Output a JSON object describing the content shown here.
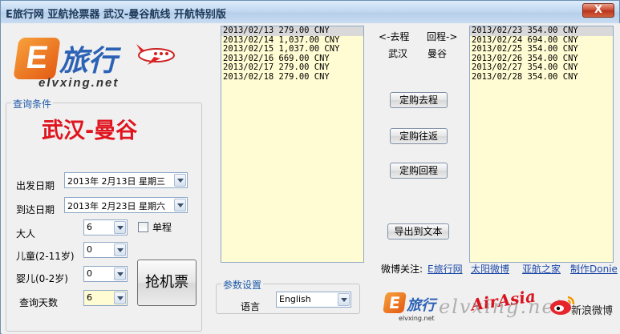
{
  "window": {
    "title": "E旅行网 亚航抢票器 武汉-曼谷航线 开航特别版",
    "close_label": "X"
  },
  "logo": {
    "mark": "E",
    "text": "旅行",
    "url": "elvxing.net"
  },
  "query": {
    "group_label": "查询条件",
    "route": "武汉-曼谷",
    "depart_label": "出发日期",
    "depart_value": "2013年 2月13日 星期三",
    "arrive_label": "到达日期",
    "arrive_value": "2013年 2月23日 星期六",
    "adult_label": "大人",
    "adult_value": "6",
    "oneway_label": "单程",
    "child_label": "儿童(2-11岁)",
    "child_value": "0",
    "infant_label": "婴儿(0-2岁)",
    "infant_value": "0",
    "days_label": "查询天数",
    "days_value": "6",
    "grab_button": "抢机票"
  },
  "params": {
    "group_label": "参数设置",
    "language_label": "语言",
    "language_value": "English"
  },
  "outbound_list": [
    "2013/02/13 279.00 CNY",
    "2013/02/14 1,037.00 CNY",
    "2013/02/15 1,037.00 CNY",
    "2013/02/16 669.00 CNY",
    "2013/02/17 279.00 CNY",
    "2013/02/18 279.00 CNY"
  ],
  "return_list": [
    "2013/02/23 354.00 CNY",
    "2013/02/24 694.00 CNY",
    "2013/02/25 354.00 CNY",
    "2013/02/26 354.00 CNY",
    "2013/02/27 354.00 CNY",
    "2013/02/28 354.00 CNY"
  ],
  "direction": {
    "outbound": "<-去程",
    "return": "回程->",
    "from_city": "武汉",
    "to_city": "曼谷"
  },
  "actions": {
    "book_outbound": "定购去程",
    "book_round": "定购往返",
    "book_return": "定购回程",
    "export_text": "导出到文本"
  },
  "weibo": {
    "label": "微博关注:",
    "links": [
      "E旅行网",
      "太阳微博",
      "亚航之家",
      "制作Donie"
    ]
  },
  "bottom": {
    "airasia": "AirAsia",
    "watermark": "elvxing.net",
    "sina": "新浪微博",
    "e_text": "旅行",
    "e_url": "elvxing.net"
  },
  "colors": {
    "route_red": "#e0141e",
    "list_bg": "#fffbd2",
    "link_blue": "#1f4aa8"
  }
}
